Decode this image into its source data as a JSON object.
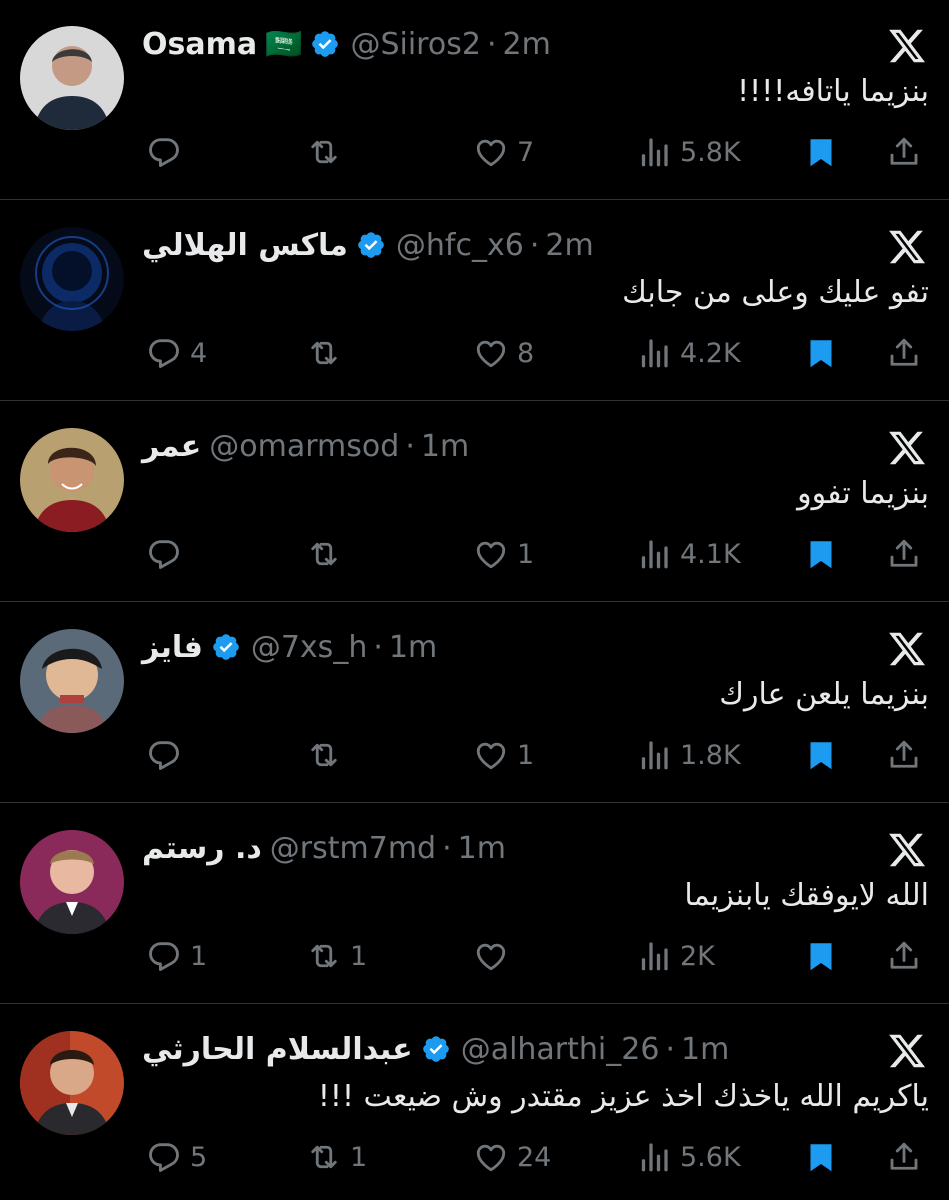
{
  "colors": {
    "background": "#000000",
    "text_primary": "#e7e9ea",
    "text_secondary": "#71767b",
    "verified": "#1d9bf0",
    "bookmark": "#1d9bf0",
    "divider": "#2f3336"
  },
  "icons": {
    "reply": "speech-bubble-icon",
    "retweet": "retweet-arrows-icon",
    "like": "heart-icon",
    "views": "bar-chart-icon",
    "bookmark": "bookmark-filled-icon",
    "share": "share-upload-icon",
    "platform": "x-logo-icon"
  },
  "tweets": [
    {
      "name": "Osama",
      "flag": "🇸🇦",
      "verified": true,
      "handle": "@Siiros2",
      "dot": "·",
      "time": "2m",
      "text": "بنزيما ياتافه!!!!",
      "replies": "",
      "retweets": "",
      "likes": "7",
      "views": "5.8K"
    },
    {
      "name": "ماكس الهلالي",
      "flag": "",
      "verified": true,
      "handle": "@hfc_x6",
      "dot": "·",
      "time": "2m",
      "text": "تفو عليك وعلى من جابك",
      "replies": "4",
      "retweets": "",
      "likes": "8",
      "views": "4.2K"
    },
    {
      "name": "عمر",
      "flag": "",
      "verified": false,
      "handle": "@omarmsod",
      "dot": "·",
      "time": "1m",
      "text": "بنزيما تفوو",
      "replies": "",
      "retweets": "",
      "likes": "1",
      "views": "4.1K"
    },
    {
      "name": "فايز",
      "flag": "",
      "verified": true,
      "handle": "@7xs_h",
      "dot": "·",
      "time": "1m",
      "text": "بنزيما يلعن عارك",
      "replies": "",
      "retweets": "",
      "likes": "1",
      "views": "1.8K"
    },
    {
      "name": "د. رستم",
      "flag": "",
      "verified": false,
      "handle": "@rstm7md",
      "dot": "·",
      "time": "1m",
      "text": "الله لايوفقك يابنزيما",
      "replies": "1",
      "retweets": "1",
      "likes": "",
      "views": "2K"
    },
    {
      "name": "عبدالسلام الحارثي",
      "flag": "",
      "verified": true,
      "handle": "@alharthi_26",
      "dot": "·",
      "time": "1m",
      "text": "ياكريم الله ياخذك اخذ عزيز مقتدر وش ضيعت !!!",
      "replies": "5",
      "retweets": "1",
      "likes": "24",
      "views": "5.6K"
    }
  ]
}
